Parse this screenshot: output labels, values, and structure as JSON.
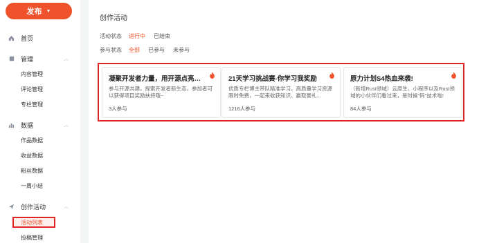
{
  "sidebar": {
    "publish_label": "发布",
    "home_label": "首页",
    "sections": [
      {
        "label": "管理",
        "items": [
          "内容管理",
          "评论管理",
          "专栏管理"
        ]
      },
      {
        "label": "数据",
        "items": [
          "作品数据",
          "收益数据",
          "粉丝数据",
          "一周小结"
        ]
      },
      {
        "label": "创作活动",
        "items": [
          "活动列表",
          "投稿管理"
        ]
      }
    ],
    "active_item": "活动列表"
  },
  "main": {
    "title": "创作活动",
    "filters": [
      {
        "label": "活动状态",
        "options": [
          "进行中",
          "已结束"
        ],
        "selected": "进行中"
      },
      {
        "label": "参与状态",
        "options": [
          "全部",
          "已参与",
          "未参与"
        ],
        "selected": "全部"
      }
    ],
    "cards": [
      {
        "title": "凝聚开发者力量，用开源点亮创新...",
        "desc": "参与开源共建，探索开发者新生态，参加者可以获得项目奖励扶持哦~",
        "count": "3人参与"
      },
      {
        "title": "21天学习挑战赛-你学习我奖励",
        "desc": "优质专栏博主带队精准学习，高质量学习资源限时免费，一起来收获知识、赢取豪礼...",
        "count": "1216人参与"
      },
      {
        "title": "原力计划S4热血来袭!",
        "desc": "（新增Rust领域）云原生、小程序以及Rust领域的小伙伴们看过来，是时候\"码\"技术啦!",
        "count": "84人参与"
      }
    ]
  },
  "colors": {
    "accent": "#f0522c",
    "highlight_border": "#e02424"
  },
  "icons": {
    "home": "home-icon",
    "manage": "manage-icon",
    "data": "bar-chart-icon",
    "activity": "send-icon",
    "hot": "fire-icon"
  }
}
